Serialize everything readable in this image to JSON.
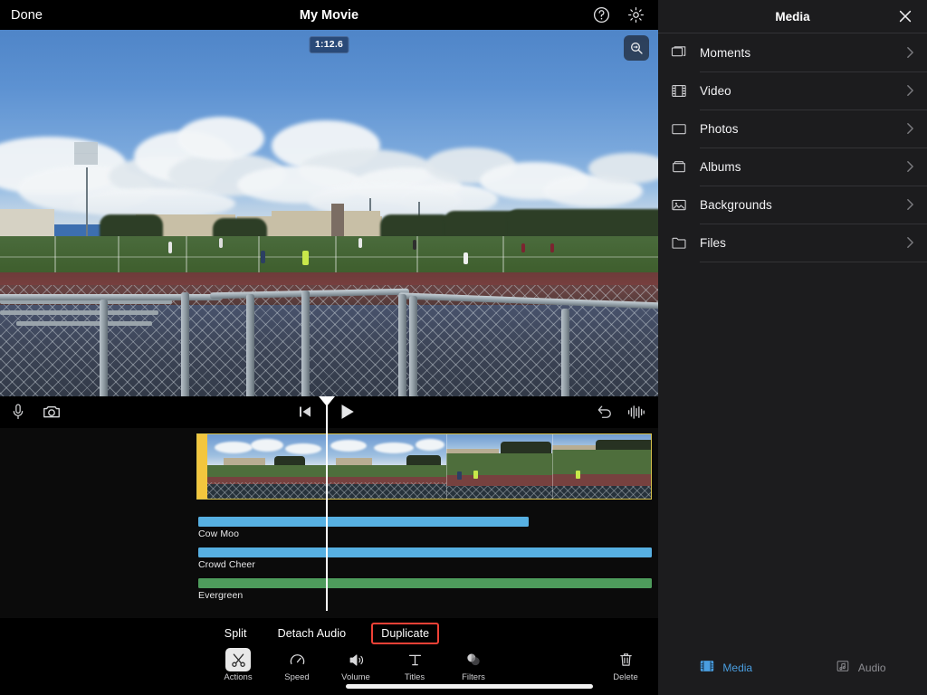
{
  "app": {
    "title": "My Movie",
    "done_label": "Done",
    "help_icon": "help-circle-icon",
    "settings_icon": "gear-icon"
  },
  "preview": {
    "timecode": "1:12.6",
    "zoom_icon": "magnifier-zoom-icon",
    "scene": "outdoor sports field behind chain-link fence, blue sky with clouds"
  },
  "playback": {
    "mic_icon": "microphone-icon",
    "camera_icon": "camera-icon",
    "skip_back_icon": "skip-to-start-icon",
    "play_icon": "play-icon",
    "undo_icon": "undo-icon",
    "waveform_icon": "audio-waveform-icon"
  },
  "timeline": {
    "video_clip_selected": true,
    "playhead_position": "1:12.6",
    "audio_tracks": [
      {
        "name": "Cow Moo",
        "color": "#57b0e2",
        "start": 0,
        "width_pct": 73
      },
      {
        "name": "Crowd Cheer",
        "color": "#57b0e2",
        "start": 0,
        "width_pct": 100
      },
      {
        "name": "Evergreen",
        "color": "#4e9c5c",
        "start": 0,
        "width_pct": 100
      }
    ]
  },
  "actions": {
    "items": [
      {
        "label": "Split",
        "highlighted": false
      },
      {
        "label": "Detach Audio",
        "highlighted": false
      },
      {
        "label": "Duplicate",
        "highlighted": true
      }
    ],
    "highlight_color": "#ef4136"
  },
  "toolbar": {
    "tools": [
      {
        "label": "Actions",
        "icon": "scissors-icon",
        "selected": true
      },
      {
        "label": "Speed",
        "icon": "speedometer-icon",
        "selected": false
      },
      {
        "label": "Volume",
        "icon": "speaker-volume-icon",
        "selected": false
      },
      {
        "label": "Titles",
        "icon": "text-title-icon",
        "selected": false
      },
      {
        "label": "Filters",
        "icon": "filters-circles-icon",
        "selected": false
      }
    ],
    "delete": {
      "label": "Delete",
      "icon": "trash-icon"
    }
  },
  "sidebar": {
    "title": "Media",
    "close_icon": "close-x-icon",
    "items": [
      {
        "label": "Moments",
        "icon": "stacked-cards-icon"
      },
      {
        "label": "Video",
        "icon": "film-strip-icon"
      },
      {
        "label": "Photos",
        "icon": "photo-rectangle-icon"
      },
      {
        "label": "Albums",
        "icon": "albums-box-icon"
      },
      {
        "label": "Backgrounds",
        "icon": "image-mountain-icon"
      },
      {
        "label": "Files",
        "icon": "folder-icon"
      }
    ],
    "chevron_icon": "chevron-right-icon",
    "tabs": [
      {
        "label": "Media",
        "icon": "film-strip-icon",
        "active": true
      },
      {
        "label": "Audio",
        "icon": "music-note-icon",
        "active": false
      }
    ],
    "active_color": "#4a9ee0"
  }
}
